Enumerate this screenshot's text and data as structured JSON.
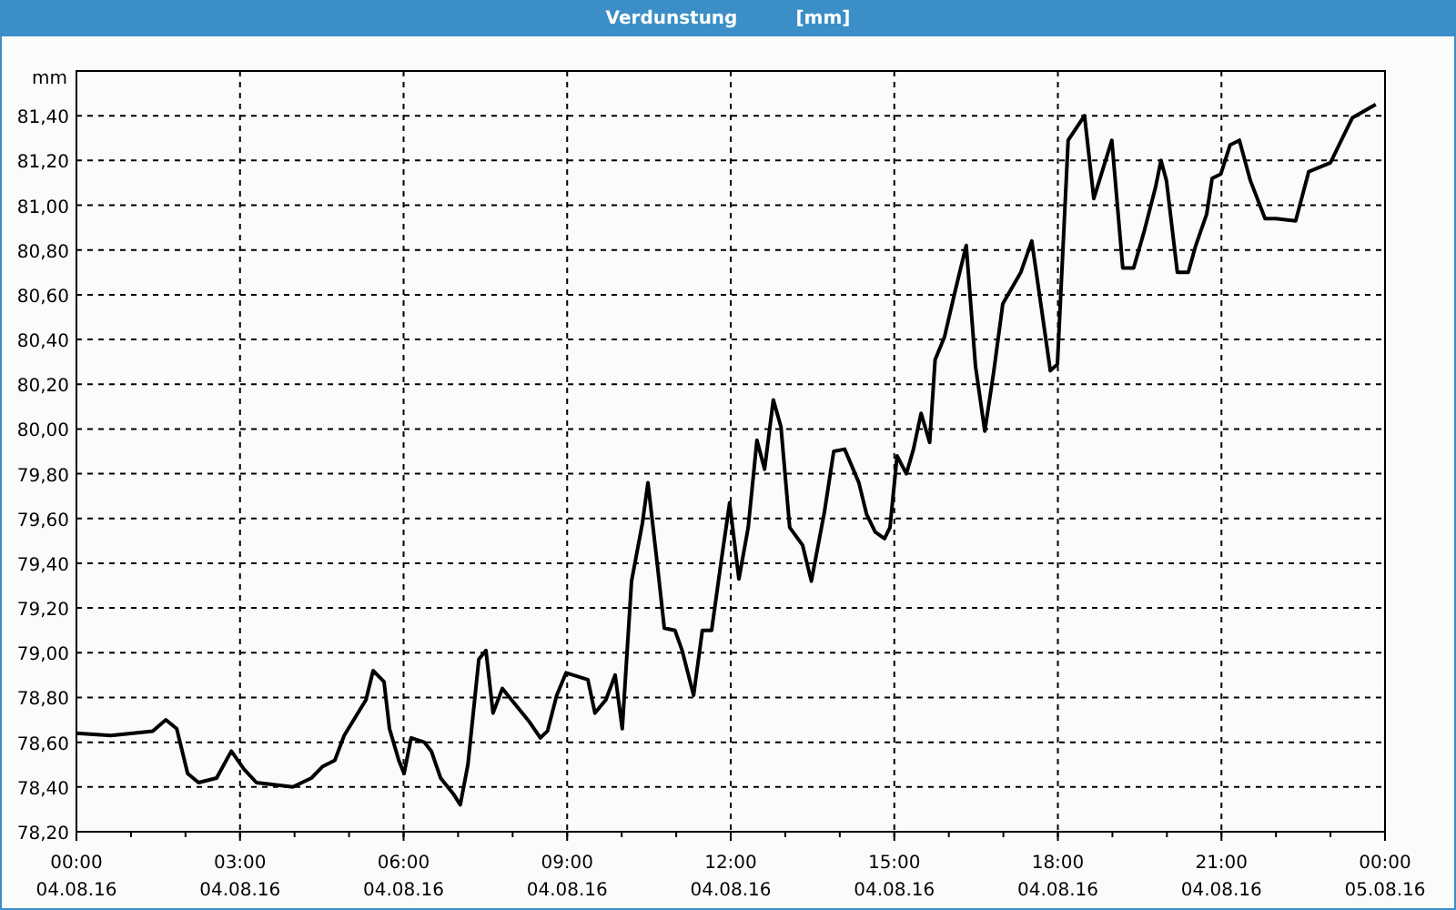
{
  "window": {
    "title": "Verdunstung",
    "unit": "[mm]"
  },
  "chart_data": {
    "type": "line",
    "ylabel": "mm",
    "grid": true,
    "xlim": [
      0,
      24
    ],
    "ylim": [
      78.2,
      81.6
    ],
    "xticks": [
      {
        "value": 0,
        "label": "00:00"
      },
      {
        "value": 3,
        "label": "03:00"
      },
      {
        "value": 6,
        "label": "06:00"
      },
      {
        "value": 9,
        "label": "09:00"
      },
      {
        "value": 12,
        "label": "12:00"
      },
      {
        "value": 15,
        "label": "15:00"
      },
      {
        "value": 18,
        "label": "18:00"
      },
      {
        "value": 21,
        "label": "21:00"
      },
      {
        "value": 24,
        "label": "00:00"
      }
    ],
    "annotations": [
      "04.08.16",
      "04.08.16",
      "04.08.16",
      "04.08.16",
      "04.08.16",
      "04.08.16",
      "04.08.16",
      "04.08.16",
      "05.08.16"
    ],
    "yticks": [
      {
        "value": 78.2,
        "label": "78,20"
      },
      {
        "value": 78.4,
        "label": "78,40"
      },
      {
        "value": 78.6,
        "label": "78,60"
      },
      {
        "value": 78.8,
        "label": "78,80"
      },
      {
        "value": 79.0,
        "label": "79,00"
      },
      {
        "value": 79.2,
        "label": "79,20"
      },
      {
        "value": 79.4,
        "label": "79,40"
      },
      {
        "value": 79.6,
        "label": "79,60"
      },
      {
        "value": 79.8,
        "label": "79,80"
      },
      {
        "value": 80.0,
        "label": "80,00"
      },
      {
        "value": 80.2,
        "label": "80,20"
      },
      {
        "value": 80.4,
        "label": "80,40"
      },
      {
        "value": 80.6,
        "label": "80,60"
      },
      {
        "value": 80.8,
        "label": "80,80"
      },
      {
        "value": 81.0,
        "label": "81,00"
      },
      {
        "value": 81.2,
        "label": "81,20"
      },
      {
        "value": 81.4,
        "label": "81,40"
      }
    ],
    "x": [
      0,
      0.63,
      1.4,
      1.64,
      1.84,
      2.04,
      2.24,
      2.57,
      2.84,
      3.07,
      3.3,
      3.97,
      4.31,
      4.51,
      4.74,
      4.91,
      5.31,
      5.44,
      5.64,
      5.74,
      5.91,
      6.01,
      6.14,
      6.38,
      6.51,
      6.68,
      6.91,
      7.04,
      7.18,
      7.38,
      7.51,
      7.64,
      7.81,
      8.31,
      8.51,
      8.64,
      8.81,
      8.98,
      9.38,
      9.51,
      9.71,
      9.88,
      10.01,
      10.18,
      10.38,
      10.48,
      10.65,
      10.78,
      10.98,
      11.11,
      11.32,
      11.48,
      11.65,
      11.82,
      11.98,
      12.15,
      12.32,
      12.48,
      12.62,
      12.78,
      12.92,
      13.08,
      13.32,
      13.48,
      13.72,
      13.89,
      14.09,
      14.35,
      14.49,
      14.65,
      14.82,
      14.92,
      15.05,
      15.22,
      15.35,
      15.49,
      15.65,
      15.75,
      15.92,
      16.12,
      16.32,
      16.49,
      16.66,
      16.82,
      16.99,
      17.32,
      17.52,
      17.72,
      17.86,
      17.99,
      18.19,
      18.49,
      18.66,
      18.99,
      19.19,
      19.39,
      19.59,
      19.79,
      19.89,
      19.99,
      20.19,
      20.39,
      20.53,
      20.73,
      20.83,
      20.99,
      21.16,
      21.33,
      21.53,
      21.8,
      22,
      22.36,
      22.6,
      23,
      23.2,
      23.4,
      23.83
    ],
    "series": [
      {
        "color": "#000000",
        "values": [
          78.64,
          78.63,
          78.65,
          78.7,
          78.66,
          78.46,
          78.42,
          78.44,
          78.56,
          78.48,
          78.42,
          78.4,
          78.44,
          78.49,
          78.52,
          78.63,
          78.79,
          78.92,
          78.87,
          78.66,
          78.52,
          78.46,
          78.62,
          78.6,
          78.56,
          78.44,
          78.37,
          78.32,
          78.5,
          78.97,
          79.01,
          78.73,
          78.84,
          78.69,
          78.62,
          78.65,
          78.81,
          78.91,
          78.88,
          78.73,
          78.79,
          78.9,
          78.66,
          79.32,
          79.58,
          79.76,
          79.4,
          79.11,
          79.1,
          79.01,
          78.81,
          79.1,
          79.1,
          79.4,
          79.67,
          79.33,
          79.56,
          79.95,
          79.82,
          80.13,
          80.01,
          79.56,
          79.48,
          79.32,
          79.63,
          79.9,
          79.91,
          79.76,
          79.62,
          79.54,
          79.51,
          79.56,
          79.88,
          79.8,
          79.91,
          80.07,
          79.94,
          80.31,
          80.41,
          80.62,
          80.82,
          80.28,
          79.99,
          80.25,
          80.56,
          80.7,
          80.84,
          80.5,
          80.26,
          80.29,
          81.29,
          81.4,
          81.03,
          81.29,
          80.72,
          80.72,
          80.89,
          81.08,
          81.2,
          81.11,
          80.7,
          80.7,
          80.82,
          80.96,
          81.12,
          81.14,
          81.27,
          81.29,
          81.11,
          80.94,
          80.94,
          80.93,
          81.15,
          81.19,
          81.29,
          81.39,
          81.45
        ]
      }
    ]
  }
}
